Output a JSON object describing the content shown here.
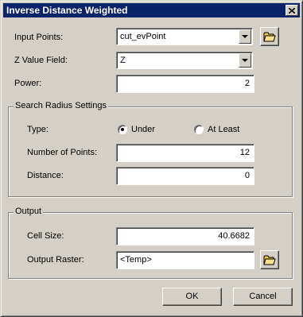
{
  "window": {
    "title": "Inverse Distance Weighted"
  },
  "form": {
    "input_points_label": "Input Points:",
    "input_points_value": "cut_evPoint",
    "z_value_field_label": "Z Value Field:",
    "z_value_field_value": "Z",
    "power_label": "Power:",
    "power_value": "2"
  },
  "search_radius": {
    "group_title": "Search Radius Settings",
    "type_label": "Type:",
    "type_options": [
      "Under",
      "At Least"
    ],
    "type_selected": "Under",
    "num_points_label": "Number of Points:",
    "num_points_value": "12",
    "distance_label": "Distance:",
    "distance_value": "0"
  },
  "output": {
    "group_title": "Output",
    "cell_size_label": "Cell Size:",
    "cell_size_value": "40.6682",
    "output_raster_label": "Output Raster:",
    "output_raster_value": "<Temp>"
  },
  "buttons": {
    "ok": "OK",
    "cancel": "Cancel"
  },
  "icons": {
    "close": "close-icon",
    "dropdown": "chevron-down-icon",
    "browse": "open-folder-icon"
  },
  "colors": {
    "title_bar": "#0a246a",
    "dialog_face": "#d4d0c8",
    "folder_icon": "#e8c34a"
  }
}
